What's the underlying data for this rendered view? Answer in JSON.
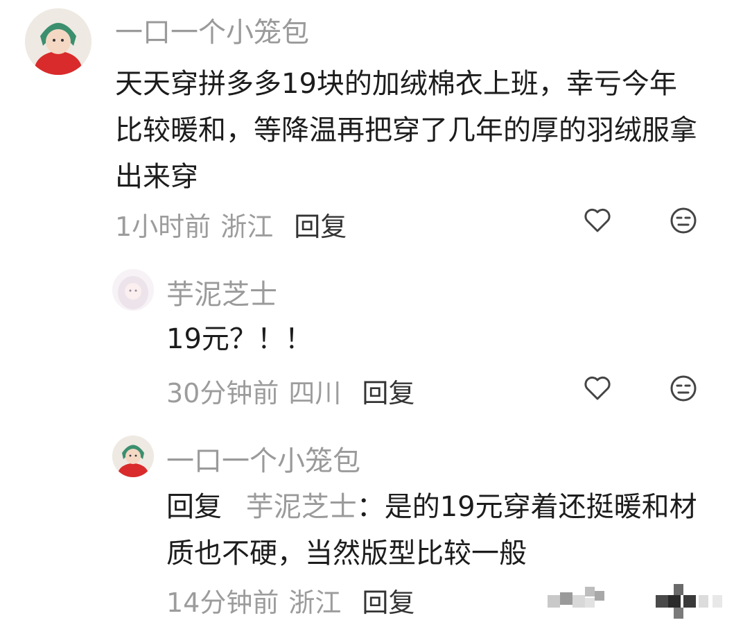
{
  "comments": [
    {
      "author": "一口一个小笼包",
      "text": "天天穿拼多多19块的加绒棉衣上班，幸亏今年比较暖和，等降温再把穿了几年的厚的羽绒服拿出来穿",
      "time": "1小时前",
      "location": "浙江",
      "reply_label": "回复"
    },
    {
      "author": "芋泥芝士",
      "text": "19元？！！",
      "time": "30分钟前",
      "location": "四川",
      "reply_label": "回复"
    },
    {
      "author": "一口一个小笼包",
      "reply_prefix": "回复",
      "reply_to": "芋泥芝士",
      "text": "：是的19元穿着还挺暖和材质也不硬，当然版型比较一般",
      "time": "14分钟前",
      "location": "浙江",
      "reply_label": "回复"
    }
  ],
  "icons": {
    "like": "heart-outline-icon",
    "dislike": "meh-face-icon"
  },
  "colors": {
    "name_gray": "#9a9a9a",
    "text_dark": "#1c1c1c",
    "avatar_red": "#d92b2b",
    "avatar_green": "#3b8f6e"
  }
}
